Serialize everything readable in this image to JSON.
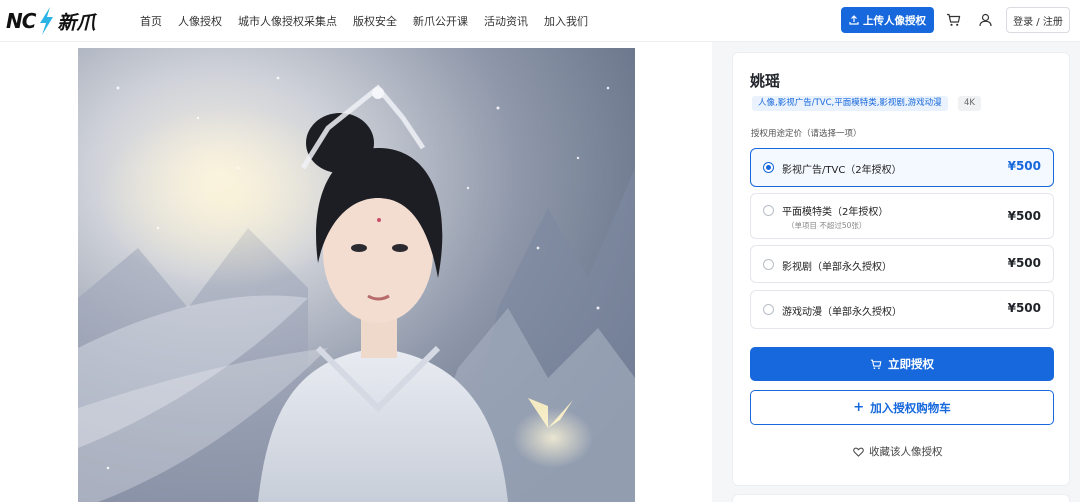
{
  "header": {
    "logo_letters": "NC",
    "logo_cn": "新爪",
    "nav": [
      "首页",
      "人像授权",
      "城市人像授权采集点",
      "版权安全",
      "新爪公开课",
      "活动资讯",
      "加入我们"
    ],
    "upload_label": "上传人像授权",
    "login_label": "登录 / 注册",
    "icons": [
      "upload-icon",
      "cart-icon",
      "user-icon"
    ]
  },
  "product": {
    "name": "姚瑶",
    "tags": [
      "人像,影视广告/TVC,平面模特类,影视剧,游戏动漫",
      "4K"
    ],
    "usage_label": "授权用途定价（请选择一项）",
    "options": [
      {
        "label": "影视广告/TVC（2年授权）",
        "sub": "",
        "price": "¥500",
        "selected": true
      },
      {
        "label": "平面模特类（2年授权）",
        "sub": "（单项目 不超过50张）",
        "price": "¥500",
        "selected": false
      },
      {
        "label": "影视剧（单部永久授权）",
        "sub": "",
        "price": "¥500",
        "selected": false
      },
      {
        "label": "游戏动漫（单部永久授权）",
        "sub": "",
        "price": "¥500",
        "selected": false
      }
    ],
    "buy_label": "立即授权",
    "cart_label": "加入授权购物车",
    "fav_label": "收藏该人像授权"
  },
  "colors": {
    "accent": "#1668dc",
    "background": "#f5f6f8"
  }
}
